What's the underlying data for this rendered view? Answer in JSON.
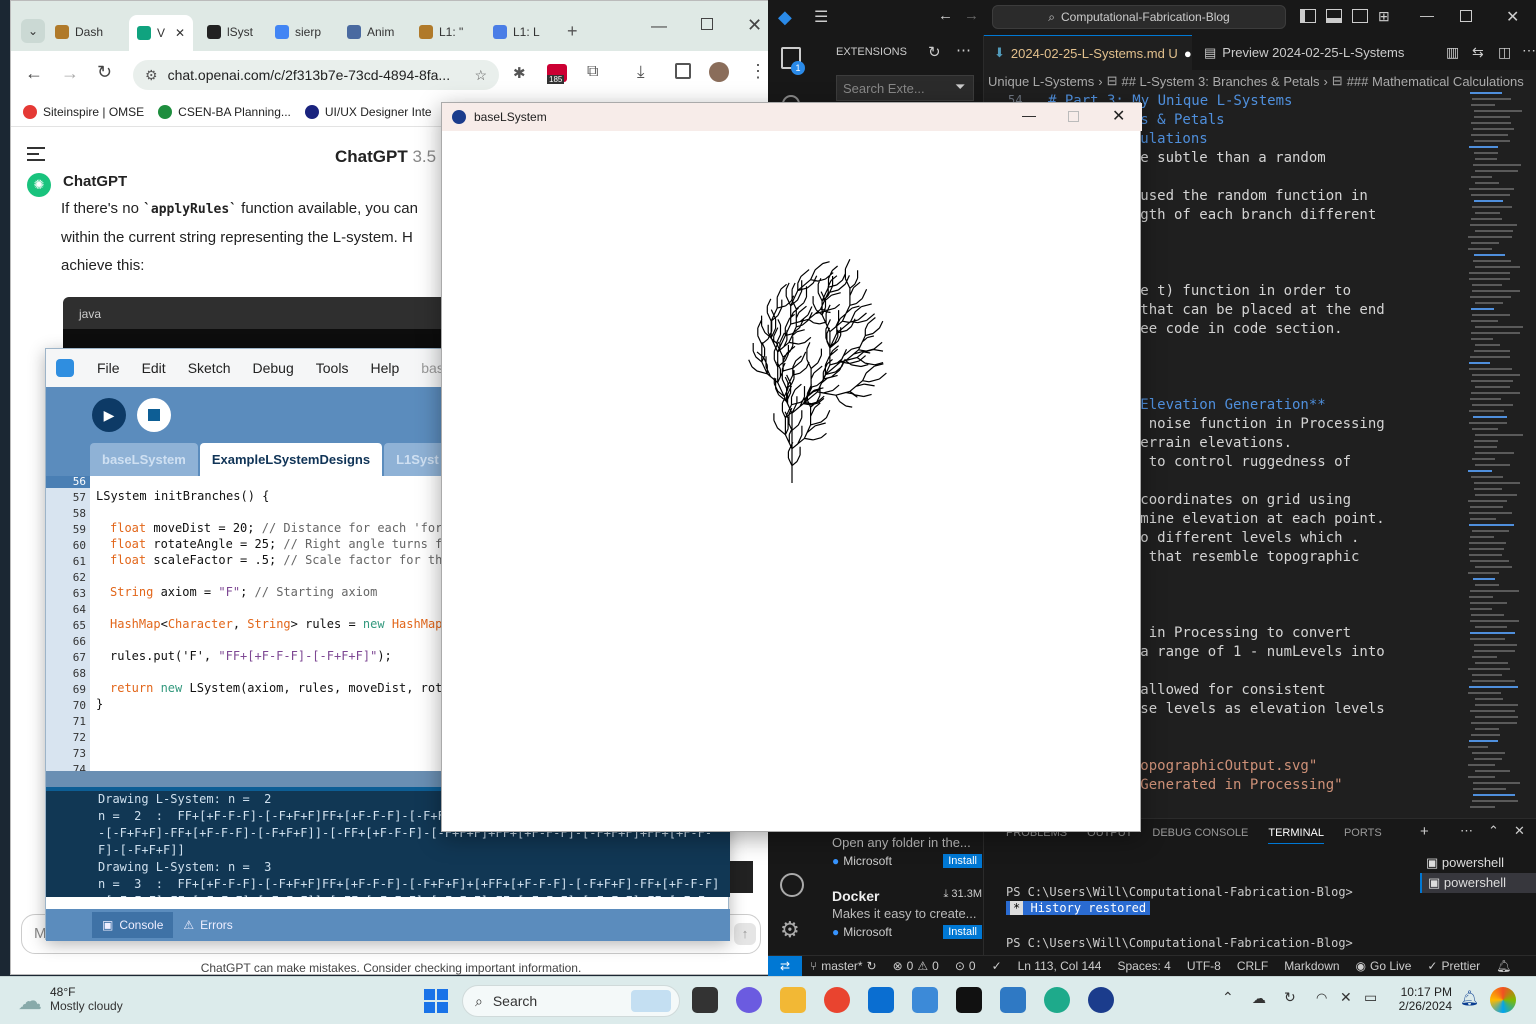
{
  "chrome": {
    "tabs": [
      {
        "label": "Dash",
        "color": "#b07a2a"
      },
      {
        "label": "V",
        "color": "#10a37f"
      },
      {
        "label": "lSyst",
        "color": "#222222"
      },
      {
        "label": "sierp",
        "color": "#4285f4"
      },
      {
        "label": "Anim",
        "color": "#4a6aa0"
      },
      {
        "label": "L1: \"",
        "color": "#b07a2a"
      },
      {
        "label": "L1: L",
        "color": "#4a7de6"
      }
    ],
    "url": "chat.openai.com/c/2f313b7e-73cd-4894-8fa...",
    "extension_badge": "185",
    "bookmarks": [
      {
        "label": "Siteinspire | OMSE",
        "color": "#e53935"
      },
      {
        "label": "CSEN-BA Planning...",
        "color": "#1e8e3e"
      },
      {
        "label": "UI/UX Designer Inte",
        "color": "#1a237e"
      }
    ]
  },
  "chatgpt": {
    "title": "ChatGPT",
    "version": "3.5",
    "sender": "ChatGPT",
    "message_1": "If there's no ",
    "message_code": "`applyRules`",
    "message_2": " function available, you can",
    "message_line2": "within the current string representing the L-system. H",
    "message_line3": "achieve this:",
    "code_lang": "java",
    "input_placeholder": "M",
    "footer": "ChatGPT can make mistakes. Consider checking important information."
  },
  "vscode": {
    "search": "Computational-Fabrication-Blog",
    "sidebar_title": "EXTENSIONS",
    "sidebar_search": "Search Exte...",
    "accounts_badge": "1",
    "tabs": [
      {
        "label": "2024-02-25-L-Systems.md U"
      },
      {
        "label": "Preview 2024-02-25-L-Systems"
      }
    ],
    "breadcrumb": [
      "Unique L-Systems",
      "## L-System 3: Branches & Petals",
      "### Mathematical Calculations"
    ],
    "editor_lines": [
      {
        "text": "# Part 3: My Unique L-Systems",
        "color": "#4f8fdc"
      },
      {
        "text": "3: Branches & Petals",
        "color": "#4f8fdc"
      },
      {
        "text": "tical Calculations",
        "color": "#4f8fdc"
      },
      {
        "text": "m, but more subtle than a random",
        "color": "#d4d4d4"
      },
      {
        "text": "",
        "color": "#d4d4d4"
      },
      {
        "text": "stance: I used the random function in",
        "color": "#d4d4d4"
      },
      {
        "text": "ke the length of each branch different",
        "color": "#d4d4d4"
      },
      {
        "text": "ique.",
        "color": "#d4d4d4"
      },
      {
        "text": "",
        "color": "#d4d4d4"
      },
      {
        "text": "**",
        "color": "#4f8fdc"
      },
      {
        "text": "Leaf(Turtle t) function in order to",
        "color": "#d4d4d4"
      },
      {
        "text": "le leaves that can be placed at the end",
        "color": "#d4d4d4"
      },
      {
        "text": "nch. Can see code in code section.",
        "color": "#d4d4d4"
      },
      {
        "text": "",
        "color": "#d4d4d4"
      },
      {
        "text": "",
        "color": "#d4d4d4"
      },
      {
        "text": "",
        "color": "#d4d4d4"
      },
      {
        "text": "ction for Elevation Generation**",
        "color": "#4f8fdc"
      },
      {
        "text": "the perlin noise function in Processing",
        "color": "#d4d4d4"
      },
      {
        "text": " natural terrain elevations.",
        "color": "#d4d4d4"
      },
      {
        "text": "ise values to control ruggedness of",
        "color": "#d4d4d4"
      },
      {
        "text": "",
        "color": "#d4d4d4"
      },
      {
        "text": "over most coordinates on grid using",
        "color": "#d4d4d4"
      },
      {
        "text": "s to determine elevation at each point.",
        "color": "#d4d4d4"
      },
      {
        "text": "evations to different levels which .",
        "color": "#d4d4d4"
      },
      {
        "text": "tour lines that resemble topographic",
        "color": "#d4d4d4"
      },
      {
        "text": "",
        "color": "#d4d4d4"
      },
      {
        "text": "",
        "color": "#d4d4d4"
      },
      {
        "text": " Mapping**",
        "color": "#4f8fdc"
      },
      {
        "text": "' function in Processing to convert",
        "color": "#d4d4d4"
      },
      {
        "text": "vels from a range of 1 - numLevels into",
        "color": "#d4d4d4"
      },
      {
        "text": "0 - 1.",
        "color": "#d4d4d4"
      },
      {
        "text": "alization allowed for consistent",
        "color": "#d4d4d4"
      },
      {
        "text": "ion of noise levels as elevation levels",
        "color": "#d4d4d4"
      },
      {
        "text": "",
        "color": "#d4d4d4"
      },
      {
        "text": "",
        "color": "#d4d4d4"
      },
      {
        "text": "./assets/topographicOutput.svg\"",
        "color": "#ce9178"
      },
      {
        "text": "aphic Map Generated in Processing\"",
        "color": "#ce9178"
      }
    ],
    "first_line_number": "54",
    "extensions": [
      {
        "desc": "Open any folder in the...",
        "publisher": "Microsoft",
        "action": "Install"
      },
      {
        "name": "Docker",
        "downloads": "31.3M",
        "desc": "Makes it easy to create...",
        "publisher": "Microsoft",
        "action": "Install"
      }
    ],
    "panel_tabs": [
      "PROBLEMS",
      "OUTPUT",
      "DEBUG CONSOLE",
      "TERMINAL",
      "PORTS"
    ],
    "terminals": [
      "powershell",
      "powershell"
    ],
    "terminal_lines": [
      "PS C:\\Users\\Will\\Computational-Fabrication-Blog>",
      "History restored",
      "PS C:\\Users\\Will\\Computational-Fabrication-Blog>"
    ],
    "status": {
      "branch": "master*",
      "errors": "0",
      "warnings": "0",
      "ports": "0",
      "position": "Ln 113, Col 144",
      "spaces": "Spaces: 4",
      "encoding": "UTF-8",
      "eol": "CRLF",
      "language": "Markdown",
      "golive": "Go Live",
      "prettier": "Prettier"
    }
  },
  "processing": {
    "menu": [
      "File",
      "Edit",
      "Sketch",
      "Debug",
      "Tools",
      "Help"
    ],
    "sketch_name": "baseL",
    "tabs": [
      "baseLSystem",
      "ExampleLSystemDesigns",
      "L1Syst"
    ],
    "line_numbers": [
      "56",
      "57",
      "58",
      "59",
      "60",
      "61",
      "62",
      "63",
      "64",
      "65",
      "66",
      "67",
      "68",
      "69",
      "70",
      "71",
      "72",
      "73",
      "74"
    ],
    "code": {
      "l57": "LSystem initBranches() {",
      "l59_ty": "float",
      "l59_rest": " moveDist = 20; ",
      "l59_cm": "// Distance for each 'forw",
      "l60_ty": "float",
      "l60_rest": " rotateAngle = 25; ",
      "l60_cm": "// Right angle turns fo",
      "l61_ty": "float",
      "l61_rest": " scaleFactor = .5; ",
      "l61_cm": "// Scale factor for the",
      "l63_ty": "String",
      "l63_a": " axiom = ",
      "l63_st": "\"F\"",
      "l63_b": "; ",
      "l63_cm": "// Starting axiom",
      "l65_ty": "HashMap",
      "l65_a": "<",
      "l65_ty2": "Character",
      "l65_b": ", ",
      "l65_ty3": "String",
      "l65_c": "> rules = ",
      "l65_nw": "new",
      "l65_d": " ",
      "l65_ty4": "HashMap",
      "l65_e": "<",
      "l67_a": "rules.put('F', ",
      "l67_st": "\"FF+[+F-F-F]-[-F+F+F]\"",
      "l67_b": ");",
      "l69_kw": "return",
      "l69_nw": " new",
      "l69_rest": " LSystem(axiom, rules, moveDist, rota",
      "l70": "}"
    },
    "console_lines": [
      "Drawing L-System: n =  2",
      "n =  2  :  FF+[+F-F-F]-[-F+F+F]FF+[+F-F-F]-[-F+F+F]+[+FF+[+F-F-F]-[-F+F+F]-FF+[+F-F-F]",
      "-[-F+F+F]-FF+[+F-F-F]-[-F+F+F]]-[-FF+[+F-F-F]-[-F+F+F]+FF+[+F-F-F]-[-F+F+F]+FF+[+F-F-",
      "F]-[-F+F+F]]",
      "Drawing L-System: n =  3",
      "n =  3  :  FF+[+F-F-F]-[-F+F+F]FF+[+F-F-F]-[-F+F+F]+[+FF+[+F-F-F]-[-F+F+F]-FF+[+F-F-F]",
      "-[-F+F+F]-FF+[+F-F-F]-[-F+F+F]]-[-FF+[+F-F-F]-[-F+F+F]+FF+[+F-F-F]-[-F+F+F]+FF+[+F-F-"
    ],
    "console_tab": "Console",
    "errors_tab": "Errors"
  },
  "sketch": {
    "title": "baseLSystem"
  },
  "taskbar": {
    "weather_temp": "48°F",
    "weather_desc": "Mostly cloudy",
    "search_label": "Search",
    "time": "10:17 PM",
    "date": "2/26/2024"
  }
}
